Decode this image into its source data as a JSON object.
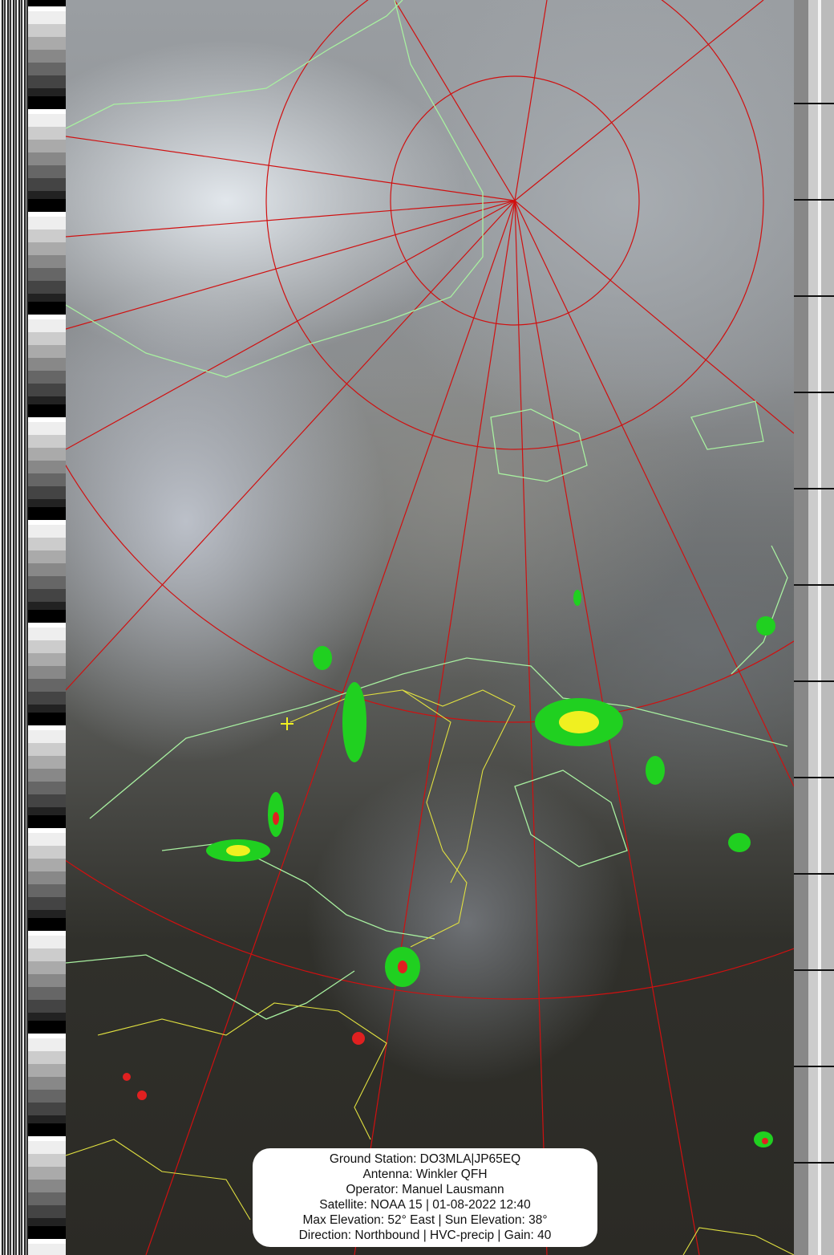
{
  "info_box": {
    "ground_station": "Ground Station: DO3MLA|JP65EQ",
    "antenna": "Antenna: Winkler QFH",
    "operator": "Operator: Manuel Lausmann",
    "satellite": "Satellite: NOAA 15 | 01-08-2022 12:40",
    "elevation": "Max Elevation: 52° East | Sun Elevation: 38°",
    "direction": "Direction: Northbound | HVC-precip | Gain: 40"
  },
  "colors": {
    "graticule": "#d01010",
    "coastline": "#a8f0a0",
    "borders": "#e0e040",
    "precip_low": "#20d020",
    "precip_mid": "#f0f020",
    "precip_high": "#e02020"
  }
}
